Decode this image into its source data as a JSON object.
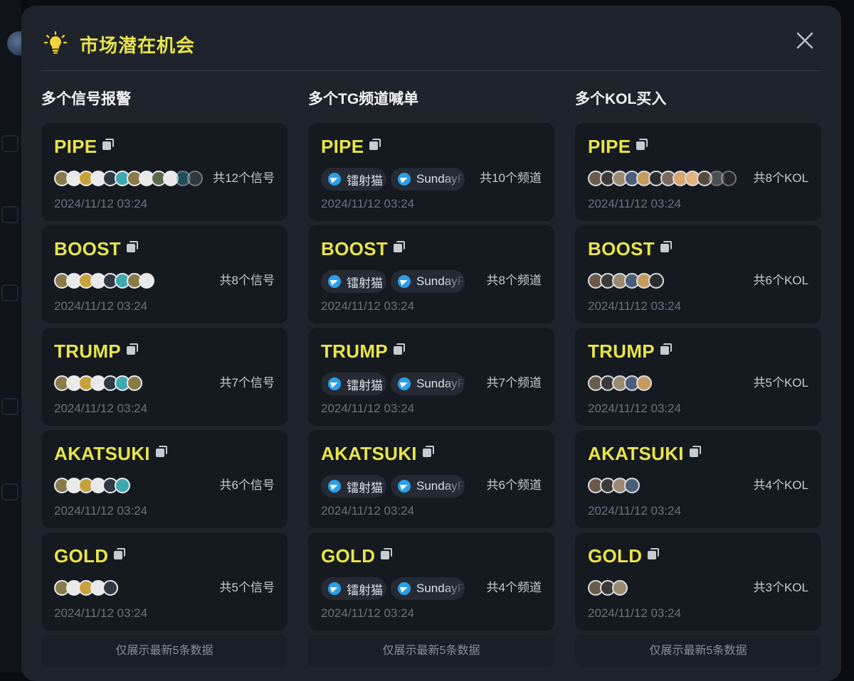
{
  "modal": {
    "title": "市场潜在机会",
    "icons": {
      "title_icon": "lightbulb-icon",
      "close_icon": "close-icon"
    },
    "colors": {
      "accent": "#e8e44a",
      "background": "#1f232c",
      "card": "#151920",
      "telegram": "#2b9fe6"
    }
  },
  "columns": [
    {
      "title": "多个信号报警",
      "type": "signal",
      "cards": [
        {
          "token": "PIPE",
          "count": "共12个信号",
          "time": "2024/11/12 03:24",
          "icon_count": 12
        },
        {
          "token": "BOOST",
          "count": "共8个信号",
          "time": "2024/11/12 03:24",
          "icon_count": 8
        },
        {
          "token": "TRUMP",
          "count": "共7个信号",
          "time": "2024/11/12 03:24",
          "icon_count": 7
        },
        {
          "token": "AKATSUKI",
          "count": "共6个信号",
          "time": "2024/11/12 03:24",
          "icon_count": 6
        },
        {
          "token": "GOLD",
          "count": "共5个信号",
          "time": "2024/11/12 03:24",
          "icon_count": 5
        }
      ],
      "footer": "仅展示最新5条数据"
    },
    {
      "title": "多个TG频道喊单",
      "type": "tg",
      "cards": [
        {
          "token": "PIPE",
          "channel1": "镭射猫",
          "channel2": "SundayFu",
          "count": "共10个频道",
          "time": "2024/11/12 03:24"
        },
        {
          "token": "BOOST",
          "channel1": "镭射猫",
          "channel2": "SundayFu",
          "count": "共8个频道",
          "time": "2024/11/12 03:24"
        },
        {
          "token": "TRUMP",
          "channel1": "镭射猫",
          "channel2": "SundayFu",
          "count": "共7个频道",
          "time": "2024/11/12 03:24"
        },
        {
          "token": "AKATSUKI",
          "channel1": "镭射猫",
          "channel2": "SundayFu",
          "count": "共6个频道",
          "time": "2024/11/12 03:24"
        },
        {
          "token": "GOLD",
          "channel1": "镭射猫",
          "channel2": "SundayFu",
          "count": "共4个频道",
          "time": "2024/11/12 03:24"
        }
      ],
      "footer": "仅展示最新5条数据"
    },
    {
      "title": "多个KOL买入",
      "type": "kol",
      "cards": [
        {
          "token": "PIPE",
          "count": "共8个KOL",
          "time": "2024/11/12 03:24",
          "icon_count": 12
        },
        {
          "token": "BOOST",
          "count": "共6个KOL",
          "time": "2024/11/12 03:24",
          "icon_count": 6
        },
        {
          "token": "TRUMP",
          "count": "共5个KOL",
          "time": "2024/11/12 03:24",
          "icon_count": 5
        },
        {
          "token": "AKATSUKI",
          "count": "共4个KOL",
          "time": "2024/11/12 03:24",
          "icon_count": 4
        },
        {
          "token": "GOLD",
          "count": "共3个KOL",
          "time": "2024/11/12 03:24",
          "icon_count": 3
        }
      ],
      "footer": "仅展示最新5条数据"
    }
  ]
}
